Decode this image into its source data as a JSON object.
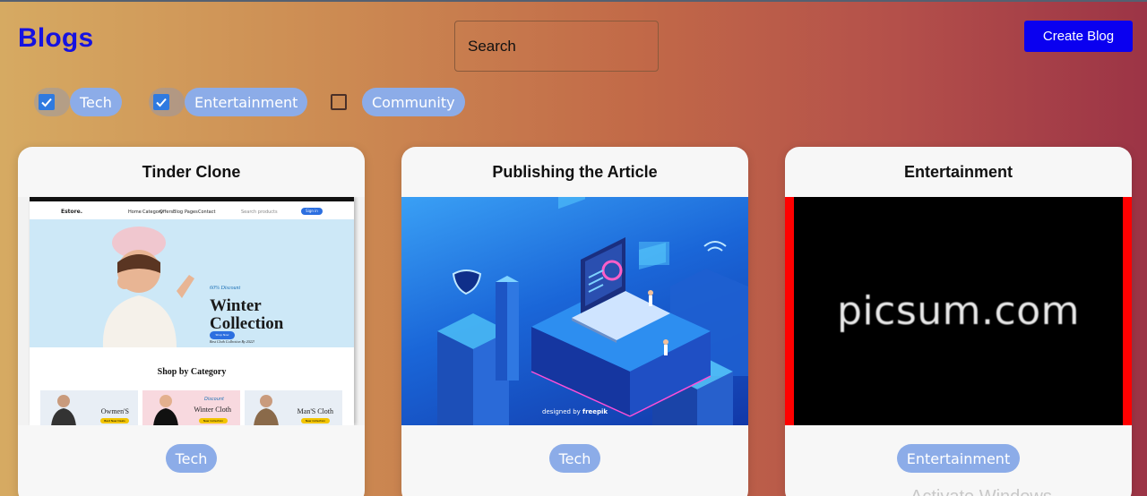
{
  "header": {
    "title": "Blogs",
    "search_placeholder": "Search",
    "create_button_label": "Create Blog"
  },
  "filters": [
    {
      "label": "Tech",
      "checked": true
    },
    {
      "label": "Entertainment",
      "checked": true
    },
    {
      "label": "Community",
      "checked": false
    }
  ],
  "cards": [
    {
      "title": "Tinder Clone",
      "tag": "Tech",
      "image": {
        "brand": "Estore.",
        "nav_items": [
          "Home",
          "Category",
          "Offers",
          "Blog",
          "Pages",
          "Contact"
        ],
        "search_label": "Search products",
        "signin_label": "Sign in",
        "discount_text": "60% Discount",
        "hero_title_line1": "Winter",
        "hero_title_line2": "Collection",
        "hero_subtitle": "Best Cloth Collection By 2022!",
        "shop_now_label": "Shop Now",
        "category_heading": "Shop by Category",
        "tiles": [
          {
            "label": "Owmen'S",
            "button": "Best New Deals"
          },
          {
            "label_top": "Discount",
            "label": "Winter Cloth",
            "button": "New Collection"
          },
          {
            "label": "Man'S Cloth",
            "button": "New Collection"
          }
        ]
      }
    },
    {
      "title": "Publishing the Article",
      "tag": "Tech",
      "image": {
        "credit": "designed by",
        "credit_brand": "freepik"
      }
    },
    {
      "title": "Entertainment",
      "tag": "Entertainment",
      "image": {
        "text": "picsum.com"
      },
      "overlay_text": "Activate Windows"
    }
  ],
  "colors": {
    "title_blue": "#1612e0",
    "button_blue": "#0a00f0",
    "chip": "#8cace8",
    "checkbox_on": "#2f7ae0"
  }
}
